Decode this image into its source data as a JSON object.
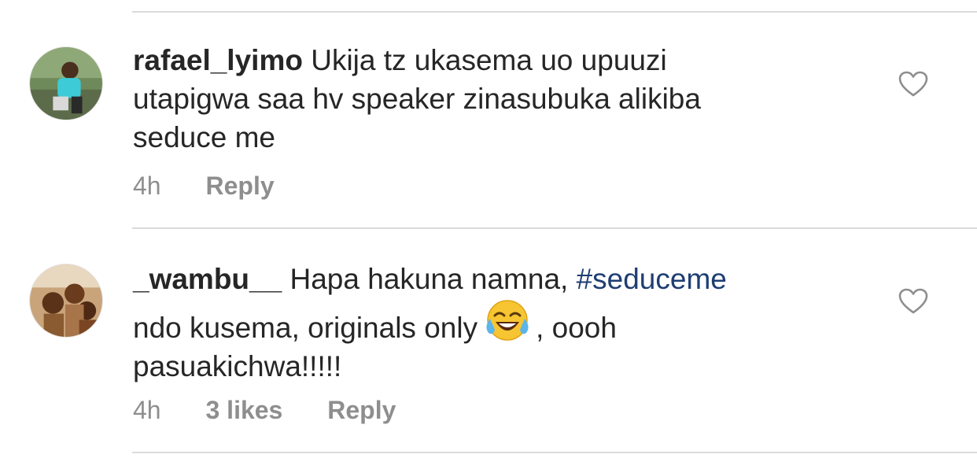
{
  "comments": [
    {
      "username": "rafael_lyimo",
      "text_line1": "Ukija tz ukasema uo  upuuzi",
      "text_line2": "utapigwa saa  hv  speaker zinasubuka alikiba",
      "text_line3": "seduce me",
      "time": "4h",
      "reply_label": "Reply",
      "avatar_icon": "user-avatar",
      "like_icon": "heart-icon"
    },
    {
      "username": "_wambu__",
      "text_before_hashtag": "Hapa hakuna namna,",
      "hashtag": "#seduceme",
      "text_line2_before_emoji": "ndo kusema, originals only",
      "emoji": "face-with-tears-of-joy",
      "text_line2_after_emoji": ", oooh",
      "text_line3": "pasuakichwa!!!!!",
      "time": "4h",
      "likes": "3 likes",
      "reply_label": "Reply",
      "avatar_icon": "user-avatar",
      "like_icon": "heart-icon"
    }
  ],
  "colors": {
    "text": "#262626",
    "meta": "#8e8e8e",
    "hashtag": "#1e3e73",
    "divider": "#dbdbdb"
  }
}
